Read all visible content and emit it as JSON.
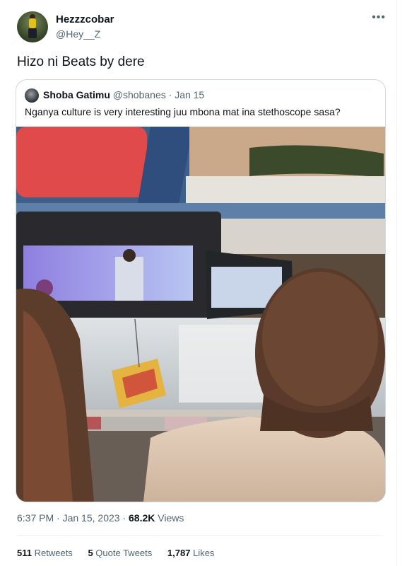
{
  "author": {
    "display_name": "Hezzzcobar",
    "handle": "@Hey__Z",
    "avatar_icon": "profile-photo"
  },
  "more_icon": "more-options-icon",
  "tweet": {
    "text": "Hizo ni Beats by dere"
  },
  "quote": {
    "author": "Shoba Gatimu",
    "handle": "@shobanes",
    "separator": "·",
    "date": "Jan 15",
    "text": "Nganya culture is very interesting juu mbona mat ina stethoscope sasa?"
  },
  "meta": {
    "time": "6:37 PM",
    "separator1": "·",
    "date": "Jan 15, 2023",
    "separator2": "·",
    "views_count": "68.2K",
    "views_label": "Views"
  },
  "stats": {
    "retweets_count": "511",
    "retweets_label": "Retweets",
    "quotes_count": "5",
    "quotes_label": "Quote Tweets",
    "likes_count": "1,787",
    "likes_label": "Likes"
  },
  "colors": {
    "text": "#0f1419",
    "secondary": "#536471",
    "border": "#cfd9de"
  }
}
